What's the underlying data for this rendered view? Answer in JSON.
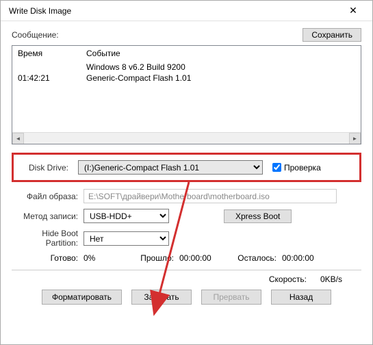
{
  "window": {
    "title": "Write Disk Image"
  },
  "msg": {
    "label": "Сообщение:",
    "save": "Сохранить"
  },
  "log": {
    "headers": {
      "time": "Время",
      "event": "Событие"
    },
    "rows": [
      {
        "time": "",
        "event": "Windows 8 v6.2 Build 9200"
      },
      {
        "time": "01:42:21",
        "event": "Generic-Compact Flash   1.01"
      }
    ]
  },
  "drive": {
    "label": "Disk Drive:",
    "value": "(I:)Generic-Compact Flash   1.01",
    "check_label": "Проверка"
  },
  "image_file": {
    "label": "Файл образа:",
    "value": "E:\\SOFT\\драйвери\\Motherboard\\motherboard.iso"
  },
  "method": {
    "label": "Метод записи:",
    "value": "USB-HDD+",
    "xpress": "Xpress Boot"
  },
  "hide_boot": {
    "label": "Hide Boot Partition:",
    "value": "Нет"
  },
  "status": {
    "ready_label": "Готово:",
    "ready_val": "0%",
    "elapsed_label": "Прошло:",
    "elapsed_val": "00:00:00",
    "remain_label": "Осталось:",
    "remain_val": "00:00:00"
  },
  "speed": {
    "label": "Скорость:",
    "value": "0KB/s"
  },
  "buttons": {
    "format": "Форматировать",
    "write": "Записать",
    "abort": "Прервать",
    "back": "Назад"
  }
}
